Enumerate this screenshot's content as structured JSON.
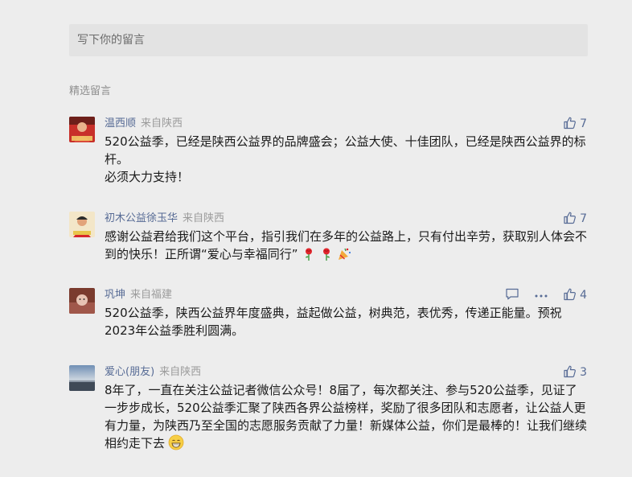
{
  "input": {
    "placeholder": "写下你的留言"
  },
  "section": {
    "title": "精选留言"
  },
  "icons": {
    "like": "thumbs-up-icon",
    "comment": "comment-icon",
    "more": "more-icon"
  },
  "colors": {
    "link": "#576b95",
    "meta": "#9b9b9b",
    "text": "#1a1a1a",
    "background": "#ededed"
  },
  "comments": [
    {
      "name": "温西顺",
      "location": "来自陕西",
      "likes": "7",
      "lines": [
        "520公益季，已经是陕西公益界的品牌盛会；公益大使、十佳团队，已经是陕西公益界的标杆。",
        "必须大力支持！"
      ]
    },
    {
      "name": "初木公益徐玉华",
      "location": "来自陕西",
      "likes": "7",
      "lines": [
        "感谢公益君给我们这个平台，指引我们在多年的公益路上，只有付出辛劳，获取别人体会不到的快乐！正所谓“爱心与幸福同行”"
      ],
      "emojis": [
        "rose-emoji",
        "rose-emoji",
        "party-popper-emoji"
      ]
    },
    {
      "name": "巩坤",
      "location": "来自福建",
      "likes": "4",
      "lines": [
        "520公益季，陕西公益界年度盛典，益起做公益，树典范，表优秀，传递正能量。预祝2023年公益季胜利圆满。"
      ]
    },
    {
      "name": "爱心(朋友)",
      "location": "来自陕西",
      "likes": "3",
      "lines": [
        "8年了，一直在关注公益记者微信公众号！8届了，每次都关注、参与520公益季，见证了一步步成长，520公益季汇聚了陕西各界公益榜样，奖励了很多团队和志愿者，让公益人更有力量，为陕西乃至全国的志愿服务贡献了力量！新媒体公益，你们是最棒的！让我们继续相约走下去"
      ],
      "emojis": [
        "grinning-emoji"
      ]
    }
  ]
}
